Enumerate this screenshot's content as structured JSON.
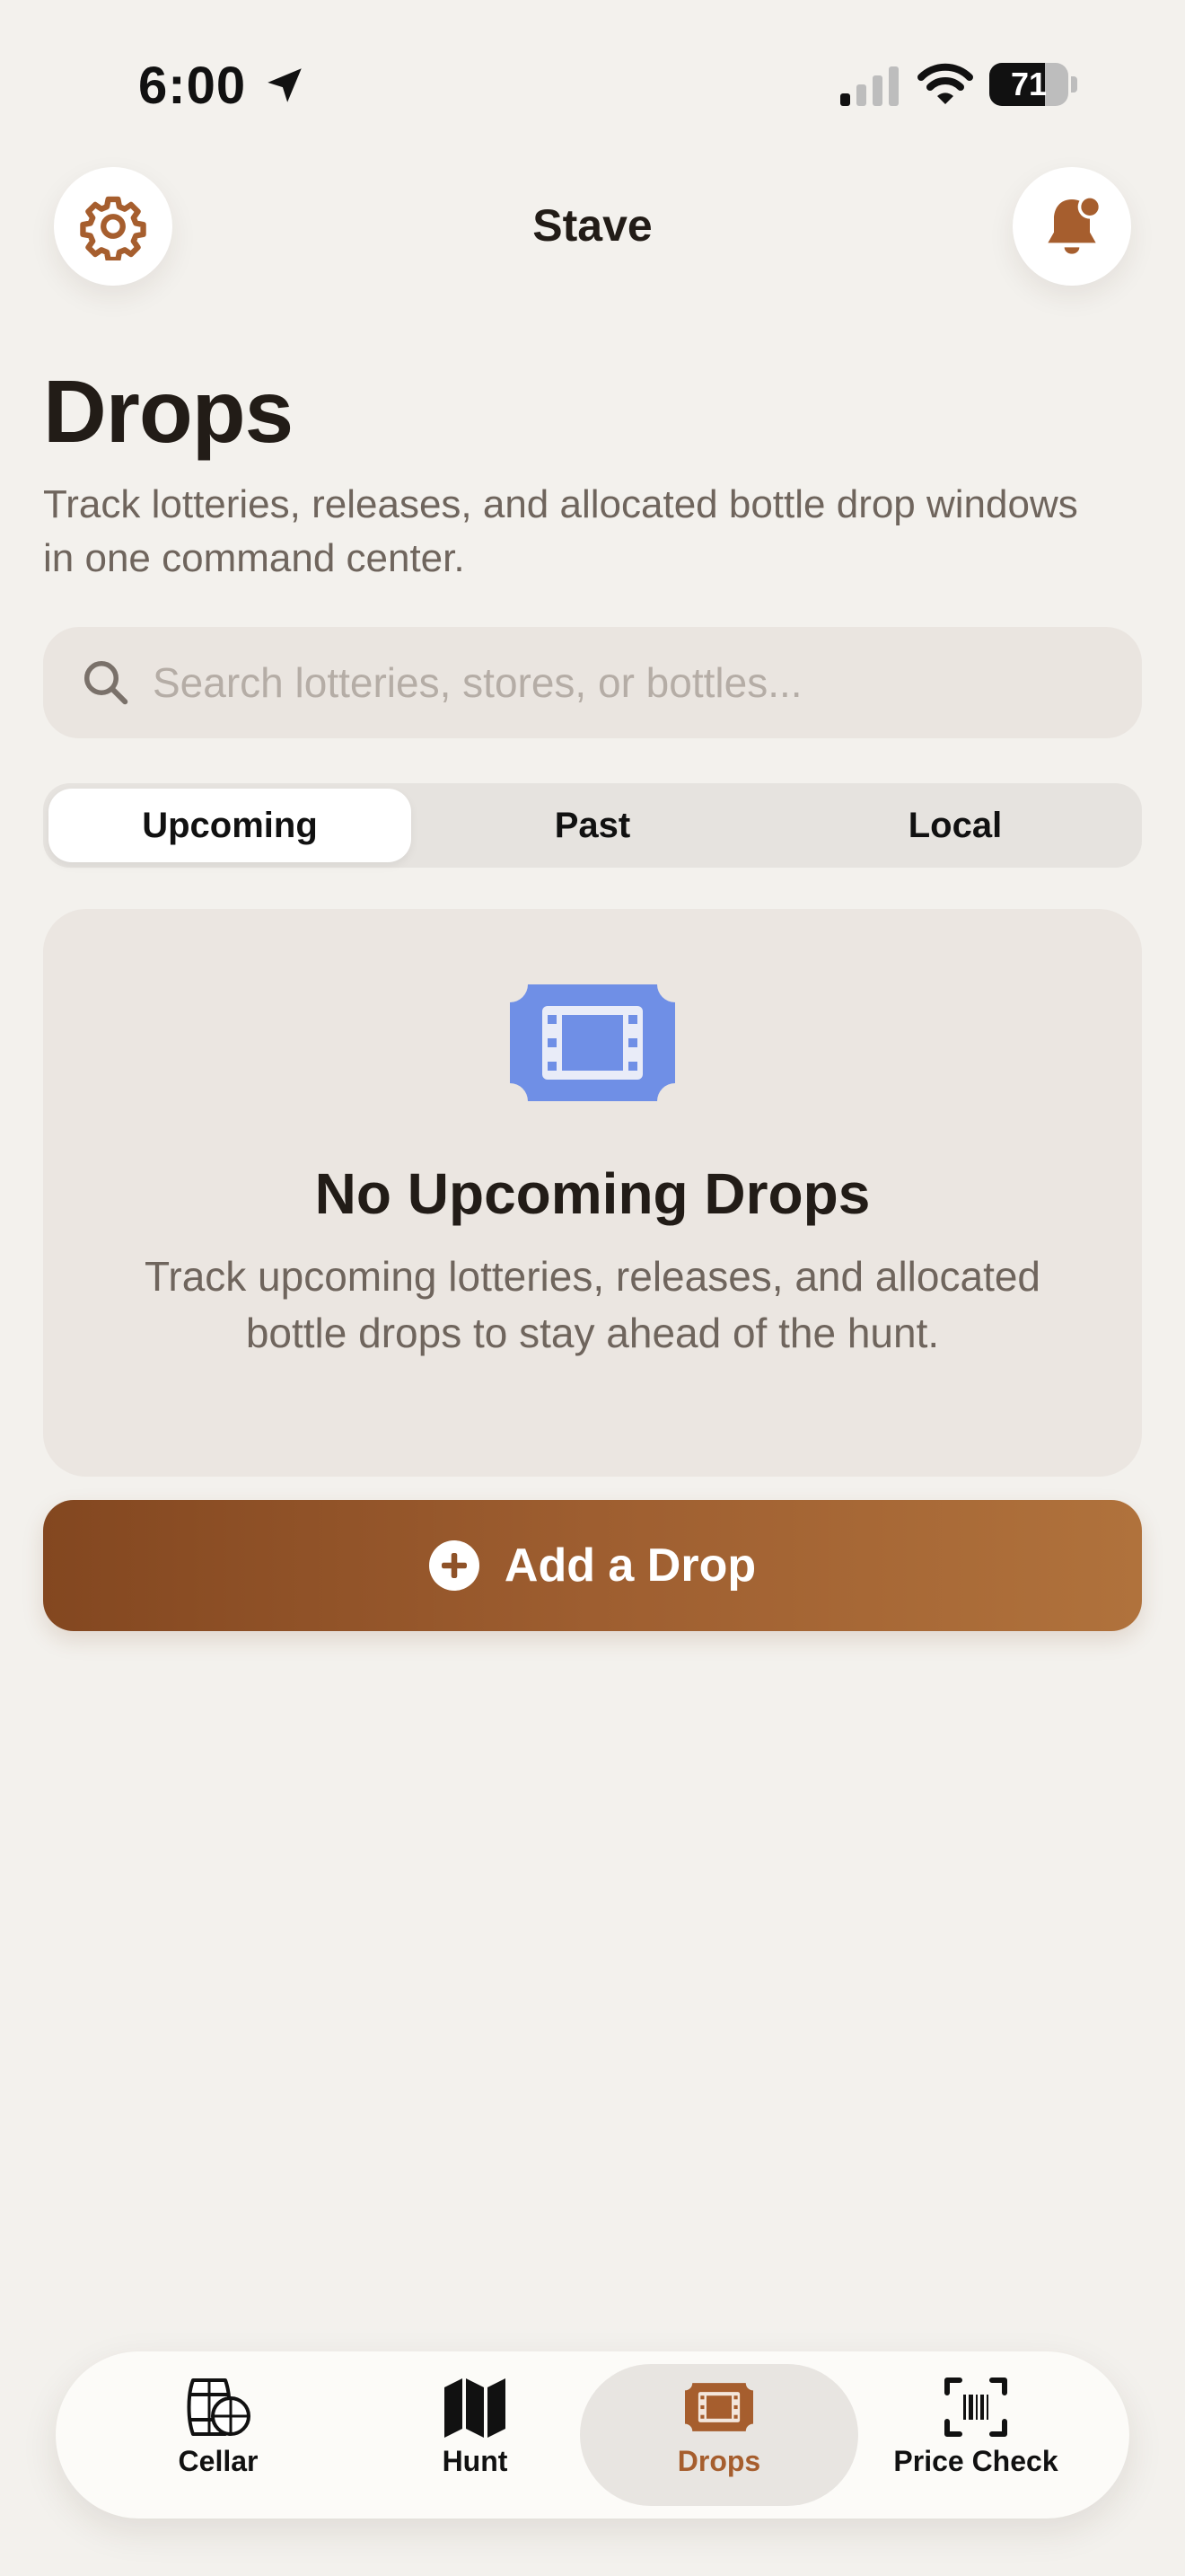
{
  "status_bar": {
    "time": "6:00",
    "battery": "71",
    "battery_level": 0.71
  },
  "header": {
    "app_title": "Stave",
    "settings_icon": "gear-icon",
    "notifications_icon": "bell-badge-icon"
  },
  "page": {
    "title": "Drops",
    "subtitle": "Track lotteries, releases, and allocated bottle drop windows in one command center."
  },
  "search": {
    "value": "",
    "placeholder": "Search lotteries, stores, or bottles..."
  },
  "segments": [
    {
      "label": "Upcoming",
      "active": true
    },
    {
      "label": "Past",
      "active": false
    },
    {
      "label": "Local",
      "active": false
    }
  ],
  "empty_state": {
    "icon": "ticket-icon",
    "title": "No Upcoming Drops",
    "text": "Track upcoming lotteries, releases, and allocated bottle drops to stay ahead of the hunt."
  },
  "add_button": {
    "label": "Add a Drop",
    "icon": "plus-circle-icon"
  },
  "tabs": [
    {
      "label": "Cellar",
      "icon": "barrel-icon",
      "active": false
    },
    {
      "label": "Hunt",
      "icon": "map-icon",
      "active": false
    },
    {
      "label": "Drops",
      "icon": "ticket-icon",
      "active": true
    },
    {
      "label": "Price Check",
      "icon": "barcode-scan-icon",
      "active": false
    }
  ],
  "colors": {
    "background": "#F3F1ED",
    "accent": "#A65E2E",
    "accent_dark": "#834720",
    "ticket_blue": "#6F8FE6",
    "text_primary": "#221C17",
    "text_secondary": "#6F655D"
  }
}
